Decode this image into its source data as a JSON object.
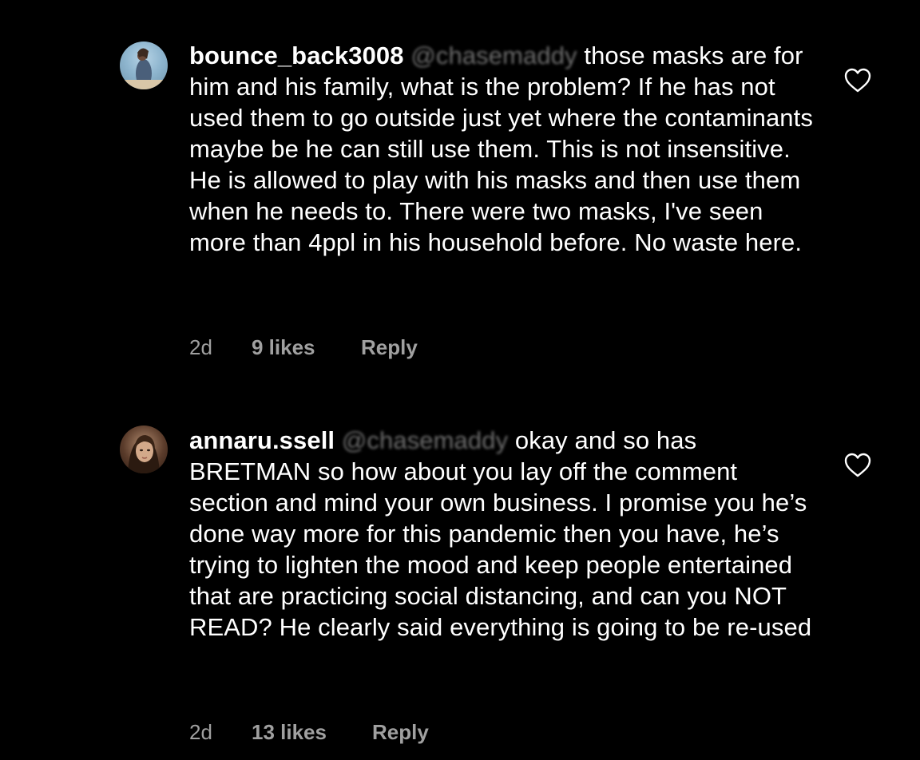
{
  "comments": [
    {
      "username": "bounce_back3008",
      "mention": "@chasemaddy",
      "text": " those masks are for him and his family, what is the problem? If he has not used them to go outside just yet where the contaminants maybe be he can still use them. This is not insensitive. He is allowed to play with his masks and then use them when he needs to. There were two masks, I've seen more than 4ppl in his household before. No waste here.",
      "time": "2d",
      "likes": "9 likes",
      "reply_label": "Reply",
      "like_icon": "heart-outline-icon"
    },
    {
      "username": "annaru.ssell",
      "mention": "@chasemaddy",
      "text": " okay and so has BRETMAN so how about you lay off the comment section and mind your own business. I promise you he’s done way more for this pandemic then you have, he’s trying to lighten the mood and keep people entertained that are practicing social distancing, and can you NOT READ? He clearly said everything is going to be re-used",
      "time": "2d",
      "likes": "13 likes",
      "reply_label": "Reply",
      "like_icon": "heart-outline-icon"
    }
  ],
  "colors": {
    "background": "#000000",
    "text": "#ffffff",
    "meta": "#a0a0a0",
    "mention_redacted": "#6d6d6d"
  }
}
